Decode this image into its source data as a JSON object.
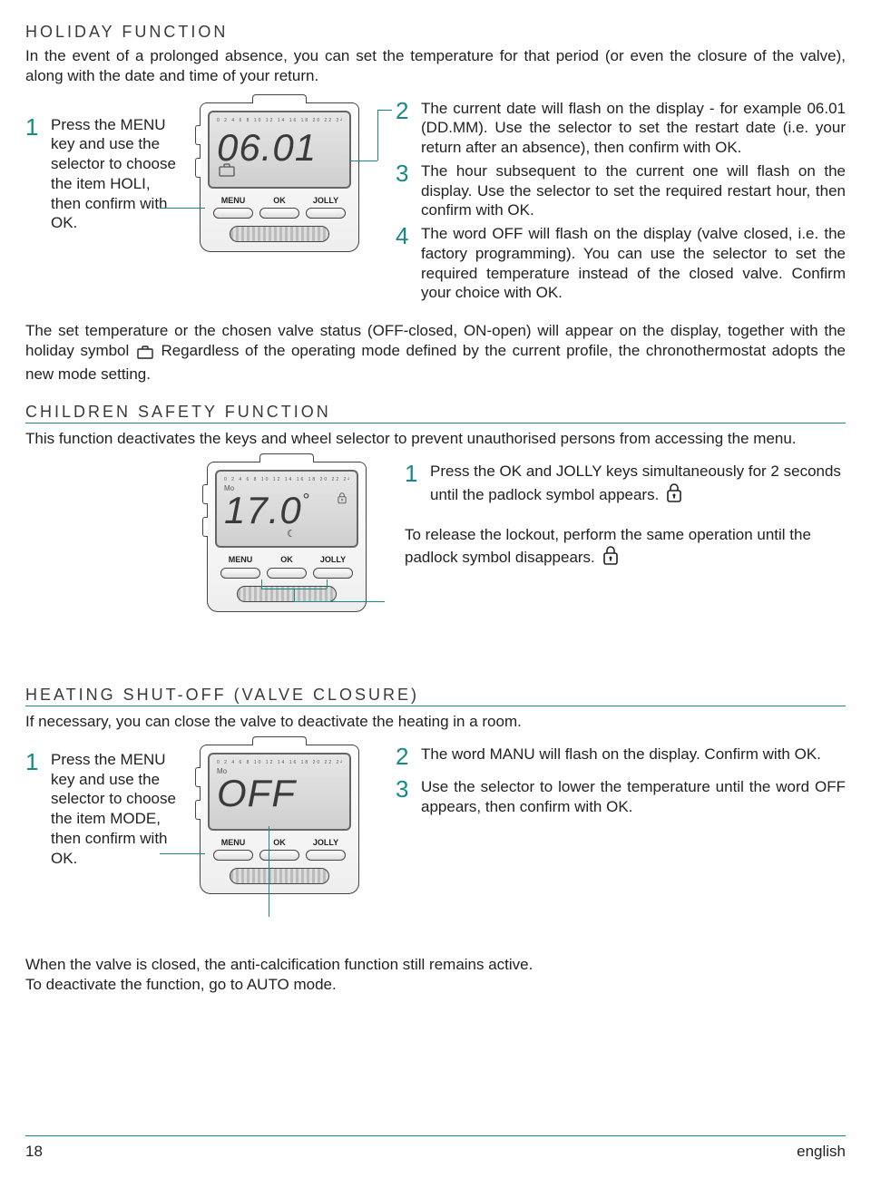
{
  "holiday": {
    "title": "HOLIDAY FUNCTION",
    "intro": "In the event of a prolonged absence, you can set the temperature for that period (or even the closure of the valve), along with the date and time of your return.",
    "step1_num": "1",
    "step1": "Press the MENU key and use the selector to choose the item HOLI, then confirm with OK.",
    "step2_num": "2",
    "step2": "The current date will flash on the display - for example 06.01 (DD.MM). Use the selector to set the restart date (i.e. your return after an absence), then confirm with OK.",
    "step3_num": "3",
    "step3": "The hour subsequent to the current one will flash on the display. Use the selector to set the required restart hour, then confirm with OK.",
    "step4_num": "4",
    "step4": "The word OFF will flash on the display (valve closed, i.e. the factory programming). You can use the selector to set the required temperature instead of the closed valve. Confirm your choice with OK.",
    "para_a": "The set temperature or the chosen valve status (OFF-closed, ON-open) will appear on the display, together with the holiday symbol",
    "para_b": "Regardless of the operating mode defined by the current profile, the chronothermostat adopts the new mode setting.",
    "device_display": "06.01",
    "btn_menu": "MENU",
    "btn_ok": "OK",
    "btn_jolly": "JOLLY"
  },
  "safety": {
    "title": "CHILDREN SAFETY FUNCTION",
    "intro": "This function deactivates the keys and wheel selector to prevent unauthorised persons from accessing the menu.",
    "step1_num": "1",
    "step1_a": "Press the OK and JOLLY keys simultaneously for 2 seconds until the padlock symbol appears.",
    "step1_b": "To release the lockout, perform the same operation until the padlock symbol disappears.",
    "device_display": "17.0",
    "device_unit": "°",
    "device_day": "Mo"
  },
  "shutoff": {
    "title": "HEATING SHUT-OFF (VALVE CLOSURE)",
    "intro": "If necessary, you can close the valve to deactivate the heating in a room.",
    "step1_num": "1",
    "step1": "Press the MENU key and use the selector to choose the item MODE, then confirm with OK.",
    "step2_num": "2",
    "step2": "The word MANU will flash on the display. Confirm with OK.",
    "step3_num": "3",
    "step3": "Use the selector to lower the temperature until the word OFF appears, then confirm with OK.",
    "note1": "When the valve is closed, the anti-calcification function still remains active.",
    "note2": "To deactivate the function, go to AUTO mode.",
    "device_display": "OFF",
    "device_day": "Mo"
  },
  "footer": {
    "page": "18",
    "lang": "english"
  }
}
